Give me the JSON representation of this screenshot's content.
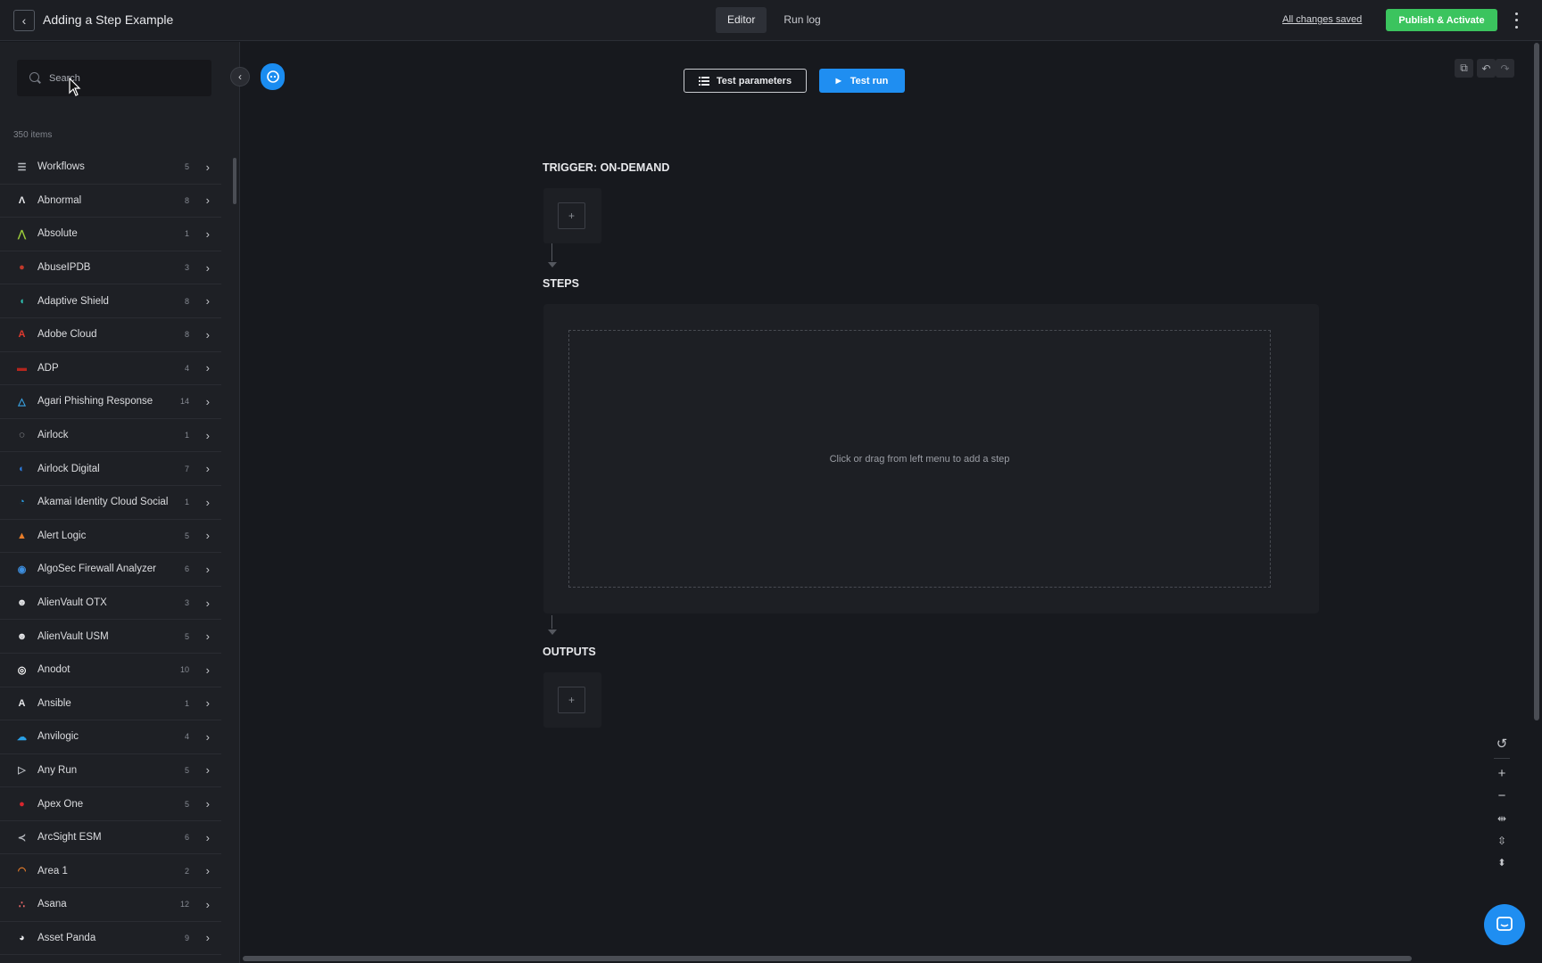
{
  "header": {
    "back_icon": "chevron-left-icon",
    "title": "Adding a Step Example",
    "tabs": [
      {
        "label": "Editor",
        "active": true
      },
      {
        "label": "Run log",
        "active": false
      }
    ],
    "save_status": "All changes saved",
    "publish_label": "Publish & Activate",
    "publish_color": "#3bc45e"
  },
  "sidebar": {
    "search": {
      "placeholder": "Search",
      "value": ""
    },
    "item_count": "350 items",
    "items": [
      {
        "label": "Workflows",
        "count": "5",
        "icon": "workflow-icon",
        "glyph": "☰",
        "color": "#b8bbc1"
      },
      {
        "label": "Abnormal",
        "count": "8",
        "icon": "abnormal-logo-icon",
        "glyph": "Λ",
        "color": "#e8e9ec"
      },
      {
        "label": "Absolute",
        "count": "1",
        "icon": "absolute-logo-icon",
        "glyph": "⋀",
        "color": "#9ccc3a"
      },
      {
        "label": "AbuseIPDB",
        "count": "3",
        "icon": "abuseipdb-logo-icon",
        "glyph": "●",
        "color": "#c0392b"
      },
      {
        "label": "Adaptive Shield",
        "count": "8",
        "icon": "adaptive-shield-logo-icon",
        "glyph": "◖",
        "color": "#2fbfb0"
      },
      {
        "label": "Adobe Cloud",
        "count": "8",
        "icon": "adobe-logo-icon",
        "glyph": "A",
        "color": "#e03a2f"
      },
      {
        "label": "ADP",
        "count": "4",
        "icon": "adp-logo-icon",
        "glyph": "▬",
        "color": "#b3261e"
      },
      {
        "label": "Agari Phishing Response",
        "count": "14",
        "icon": "agari-logo-icon",
        "glyph": "△",
        "color": "#3aa5e6"
      },
      {
        "label": "Airlock",
        "count": "1",
        "icon": "airlock-logo-icon",
        "glyph": "◌",
        "color": "#d0d2d6"
      },
      {
        "label": "Airlock Digital",
        "count": "7",
        "icon": "airlock-digital-logo-icon",
        "glyph": "◐",
        "color": "#2e7de0"
      },
      {
        "label": "Akamai Identity Cloud Social",
        "count": "1",
        "icon": "akamai-logo-icon",
        "glyph": "◔",
        "color": "#2aa0e6"
      },
      {
        "label": "Alert Logic",
        "count": "5",
        "icon": "alert-logic-logo-icon",
        "glyph": "▲",
        "color": "#e87d2a"
      },
      {
        "label": "AlgoSec Firewall Analyzer",
        "count": "6",
        "icon": "algosec-logo-icon",
        "glyph": "◉",
        "color": "#3d8fe0"
      },
      {
        "label": "AlienVault OTX",
        "count": "3",
        "icon": "alienvault-otx-logo-icon",
        "glyph": "☻",
        "color": "#e8e9ec"
      },
      {
        "label": "AlienVault USM",
        "count": "5",
        "icon": "alienvault-usm-logo-icon",
        "glyph": "☻",
        "color": "#e8e9ec"
      },
      {
        "label": "Anodot",
        "count": "10",
        "icon": "anodot-logo-icon",
        "glyph": "◎",
        "color": "#ffffff"
      },
      {
        "label": "Ansible",
        "count": "1",
        "icon": "ansible-logo-icon",
        "glyph": "A",
        "color": "#e8e9ec"
      },
      {
        "label": "Anvilogic",
        "count": "4",
        "icon": "anvilogic-logo-icon",
        "glyph": "☁",
        "color": "#2aa0e6"
      },
      {
        "label": "Any Run",
        "count": "5",
        "icon": "any-run-logo-icon",
        "glyph": "▷",
        "color": "#b8bbc1"
      },
      {
        "label": "Apex One",
        "count": "5",
        "icon": "apex-one-logo-icon",
        "glyph": "●",
        "color": "#d8262e"
      },
      {
        "label": "ArcSight ESM",
        "count": "6",
        "icon": "arcsight-logo-icon",
        "glyph": "≺",
        "color": "#b8bbc1"
      },
      {
        "label": "Area 1",
        "count": "2",
        "icon": "area1-logo-icon",
        "glyph": "◠",
        "color": "#e87d2a"
      },
      {
        "label": "Asana",
        "count": "12",
        "icon": "asana-logo-icon",
        "glyph": "∴",
        "color": "#f06a6a"
      },
      {
        "label": "Asset Panda",
        "count": "9",
        "icon": "asset-panda-logo-icon",
        "glyph": "◕",
        "color": "#e8e9ec"
      }
    ]
  },
  "toolbar": {
    "test_params_label": "Test parameters",
    "test_run_label": "Test run"
  },
  "canvas": {
    "trigger_label": "TRIGGER: ON-DEMAND",
    "steps_label": "STEPS",
    "steps_hint": "Click or drag from left menu to add a step",
    "outputs_label": "OUTPUTS",
    "add_symbol": "+"
  },
  "zoom_controls": [
    "reset-zoom-icon",
    "zoom-in-icon",
    "zoom-out-icon",
    "fit-horizontal-icon",
    "fit-vertical-icon",
    "expand-collapse-icon"
  ],
  "colors": {
    "accent": "#1f8ef1",
    "success": "#3bc45e",
    "background": "#17191e"
  }
}
